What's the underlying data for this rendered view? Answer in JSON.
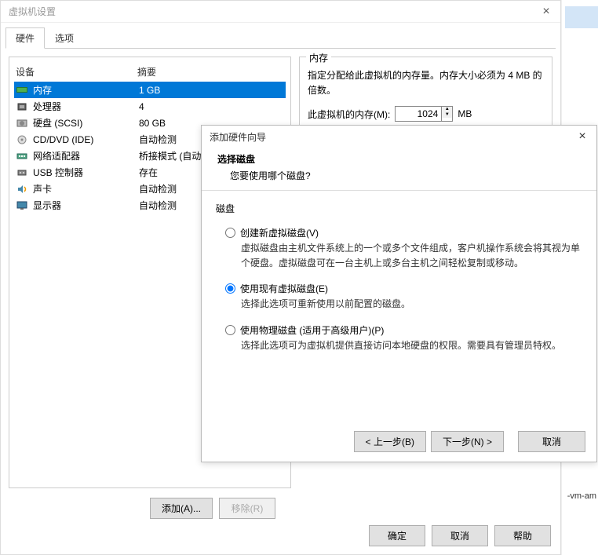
{
  "mainWindow": {
    "title": "虚拟机设置",
    "tabs": {
      "hardware": "硬件",
      "options": "选项"
    },
    "headers": {
      "device": "设备",
      "summary": "摘要"
    },
    "devices": [
      {
        "key": "memory",
        "name": "内存",
        "summary": "1 GB"
      },
      {
        "key": "cpu",
        "name": "处理器",
        "summary": "4"
      },
      {
        "key": "hdd",
        "name": "硬盘 (SCSI)",
        "summary": "80 GB"
      },
      {
        "key": "cd",
        "name": "CD/DVD (IDE)",
        "summary": "自动检测"
      },
      {
        "key": "net",
        "name": "网络适配器",
        "summary": "桥接模式 (自动)"
      },
      {
        "key": "usb",
        "name": "USB 控制器",
        "summary": "存在"
      },
      {
        "key": "sound",
        "name": "声卡",
        "summary": "自动检测"
      },
      {
        "key": "display",
        "name": "显示器",
        "summary": "自动检测"
      }
    ],
    "memory": {
      "legend": "内存",
      "desc": "指定分配给此虚拟机的内存量。内存大小必须为 4 MB 的倍数。",
      "label": "此虚拟机的内存(M):",
      "value": "1024",
      "unit": "MB"
    },
    "buttons": {
      "add": "添加(A)...",
      "remove": "移除(R)",
      "ok": "确定",
      "cancel": "取消",
      "help": "帮助"
    }
  },
  "wizard": {
    "title": "添加硬件向导",
    "headerTitle": "选择磁盘",
    "headerSubtitle": "您要使用哪个磁盘?",
    "groupLabel": "磁盘",
    "options": {
      "createNew": {
        "label": "创建新虚拟磁盘(V)",
        "desc": "虚拟磁盘由主机文件系统上的一个或多个文件组成，客户机操作系统会将其视为单个硬盘。虚拟磁盘可在一台主机上或多台主机之间轻松复制或移动。"
      },
      "useExisting": {
        "label": "使用现有虚拟磁盘(E)",
        "desc": "选择此选项可重新使用以前配置的磁盘。"
      },
      "usePhysical": {
        "label": "使用物理磁盘 (适用于高级用户)(P)",
        "desc": "选择此选项可为虚拟机提供直接访问本地硬盘的权限。需要具有管理员特权。"
      }
    },
    "buttons": {
      "back": "< 上一步(B)",
      "next": "下一步(N) >",
      "cancel": "取消"
    }
  },
  "stray": {
    "vmam": "-vm-am"
  }
}
